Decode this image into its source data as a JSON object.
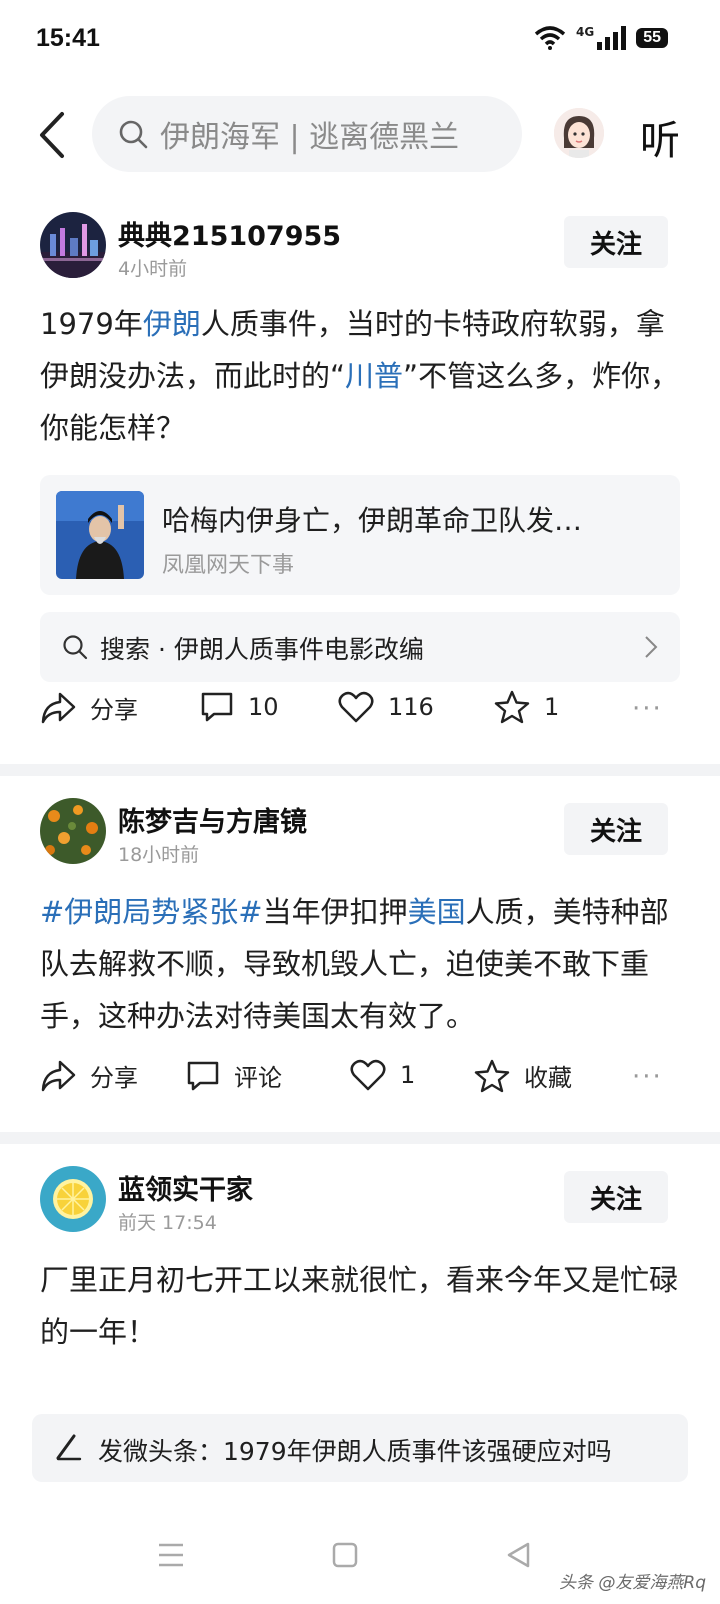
{
  "status_bar": {
    "time": "15:41",
    "network": "4G",
    "battery": "55"
  },
  "header": {
    "search_placeholder": "伊朗海军 | 逃离德黑兰",
    "listen_label": "听"
  },
  "posts": [
    {
      "user": "典典215107955",
      "time": "4小时前",
      "follow": "关注",
      "text": [
        {
          "t": "1979年",
          "hl": false
        },
        {
          "t": "伊朗",
          "hl": true
        },
        {
          "t": "人质事件，当时的卡特政府软弱，拿伊朗没办法，而此时的“",
          "hl": false
        },
        {
          "t": "川普",
          "hl": true
        },
        {
          "t": "”不管这么多，炸你，你能怎样？",
          "hl": false
        }
      ],
      "card": {
        "title": "哈梅内伊身亡，伊朗革命卫队发…",
        "source": "凤凰网天下事"
      },
      "search_suggest": "搜索 · 伊朗人质事件电影改编",
      "actions": {
        "share": "分享",
        "comments": "10",
        "likes": "116",
        "favorites": "1"
      }
    },
    {
      "user": "陈梦吉与方唐镜",
      "time": "18小时前",
      "follow": "关注",
      "text": [
        {
          "t": "#伊朗局势紧张#",
          "hl": true
        },
        {
          "t": "当年伊扣押",
          "hl": false
        },
        {
          "t": "美国",
          "hl": true
        },
        {
          "t": "人质，美特种部队去解救不顺，导致机毁人亡，迫使美不敢下重手，这种办法对待美国太有效了。",
          "hl": false
        }
      ],
      "actions": {
        "share": "分享",
        "comments": "评论",
        "likes": "1",
        "favorites": "收藏"
      }
    },
    {
      "user": "蓝领实干家",
      "time": "前天  17:54",
      "follow": "关注",
      "text": [
        {
          "t": "厂里正月初七开工以来就很忙，看来今年又是忙碌的一年！",
          "hl": false
        }
      ]
    }
  ],
  "publish_bar": {
    "label": "发微头条：1979年伊朗人质事件该强硬应对吗"
  },
  "watermark": "头条 @友爱海燕Rq",
  "colors": {
    "link": "#2a6fb8",
    "background": "#ffffff",
    "panel": "#f3f4f6"
  }
}
